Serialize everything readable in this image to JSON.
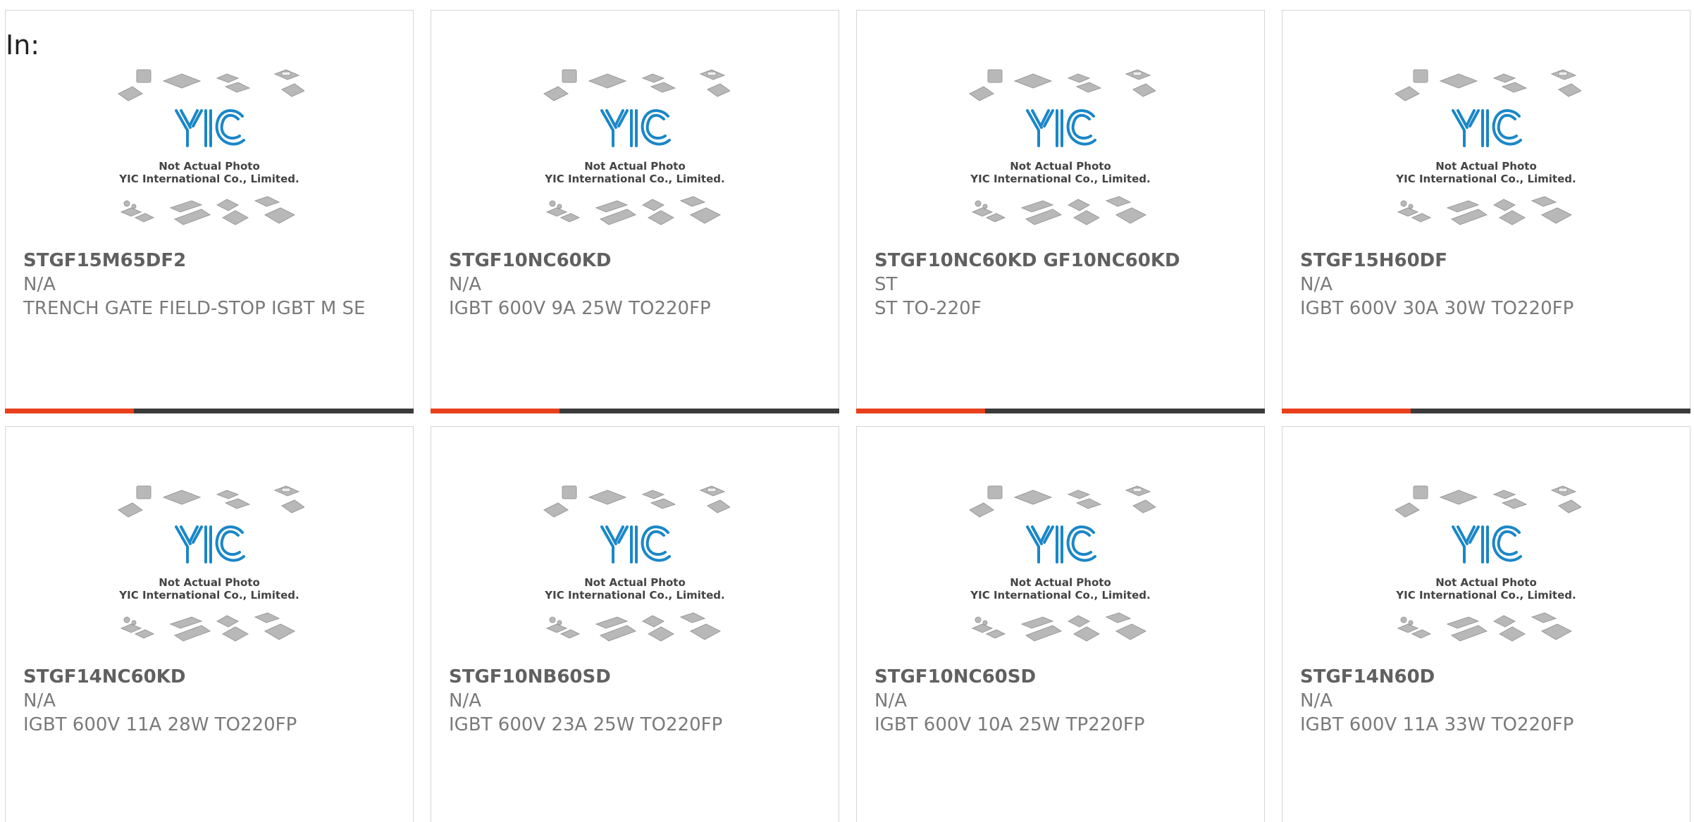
{
  "filter_label": "In:",
  "colors": {
    "accent": "#e8401c",
    "bar": "#3b3b3b",
    "logo_blue": "#1a87c8"
  },
  "placeholder_image": {
    "line1": "Not Actual Photo",
    "line2": "YIC International Co., Limited.",
    "logo_text": "YIC"
  },
  "products": [
    {
      "part_number": "STGF15M65DF2",
      "manufacturer": "N/A",
      "description": "TRENCH GATE FIELD-STOP IGBT M SE"
    },
    {
      "part_number": "STGF10NC60KD",
      "manufacturer": "N/A",
      "description": "IGBT 600V 9A 25W TO220FP"
    },
    {
      "part_number": "STGF10NC60KD GF10NC60KD",
      "manufacturer": "ST",
      "description": "ST TO-220F"
    },
    {
      "part_number": "STGF15H60DF",
      "manufacturer": "N/A",
      "description": "IGBT 600V 30A 30W TO220FP"
    },
    {
      "part_number": "STGF14NC60KD",
      "manufacturer": "N/A",
      "description": "IGBT 600V 11A 28W TO220FP"
    },
    {
      "part_number": "STGF10NB60SD",
      "manufacturer": "N/A",
      "description": "IGBT 600V 23A 25W TO220FP"
    },
    {
      "part_number": "STGF10NC60SD",
      "manufacturer": "N/A",
      "description": "IGBT 600V 10A 25W TP220FP"
    },
    {
      "part_number": "STGF14N60D",
      "manufacturer": "N/A",
      "description": "IGBT 600V 11A 33W TO220FP"
    }
  ]
}
